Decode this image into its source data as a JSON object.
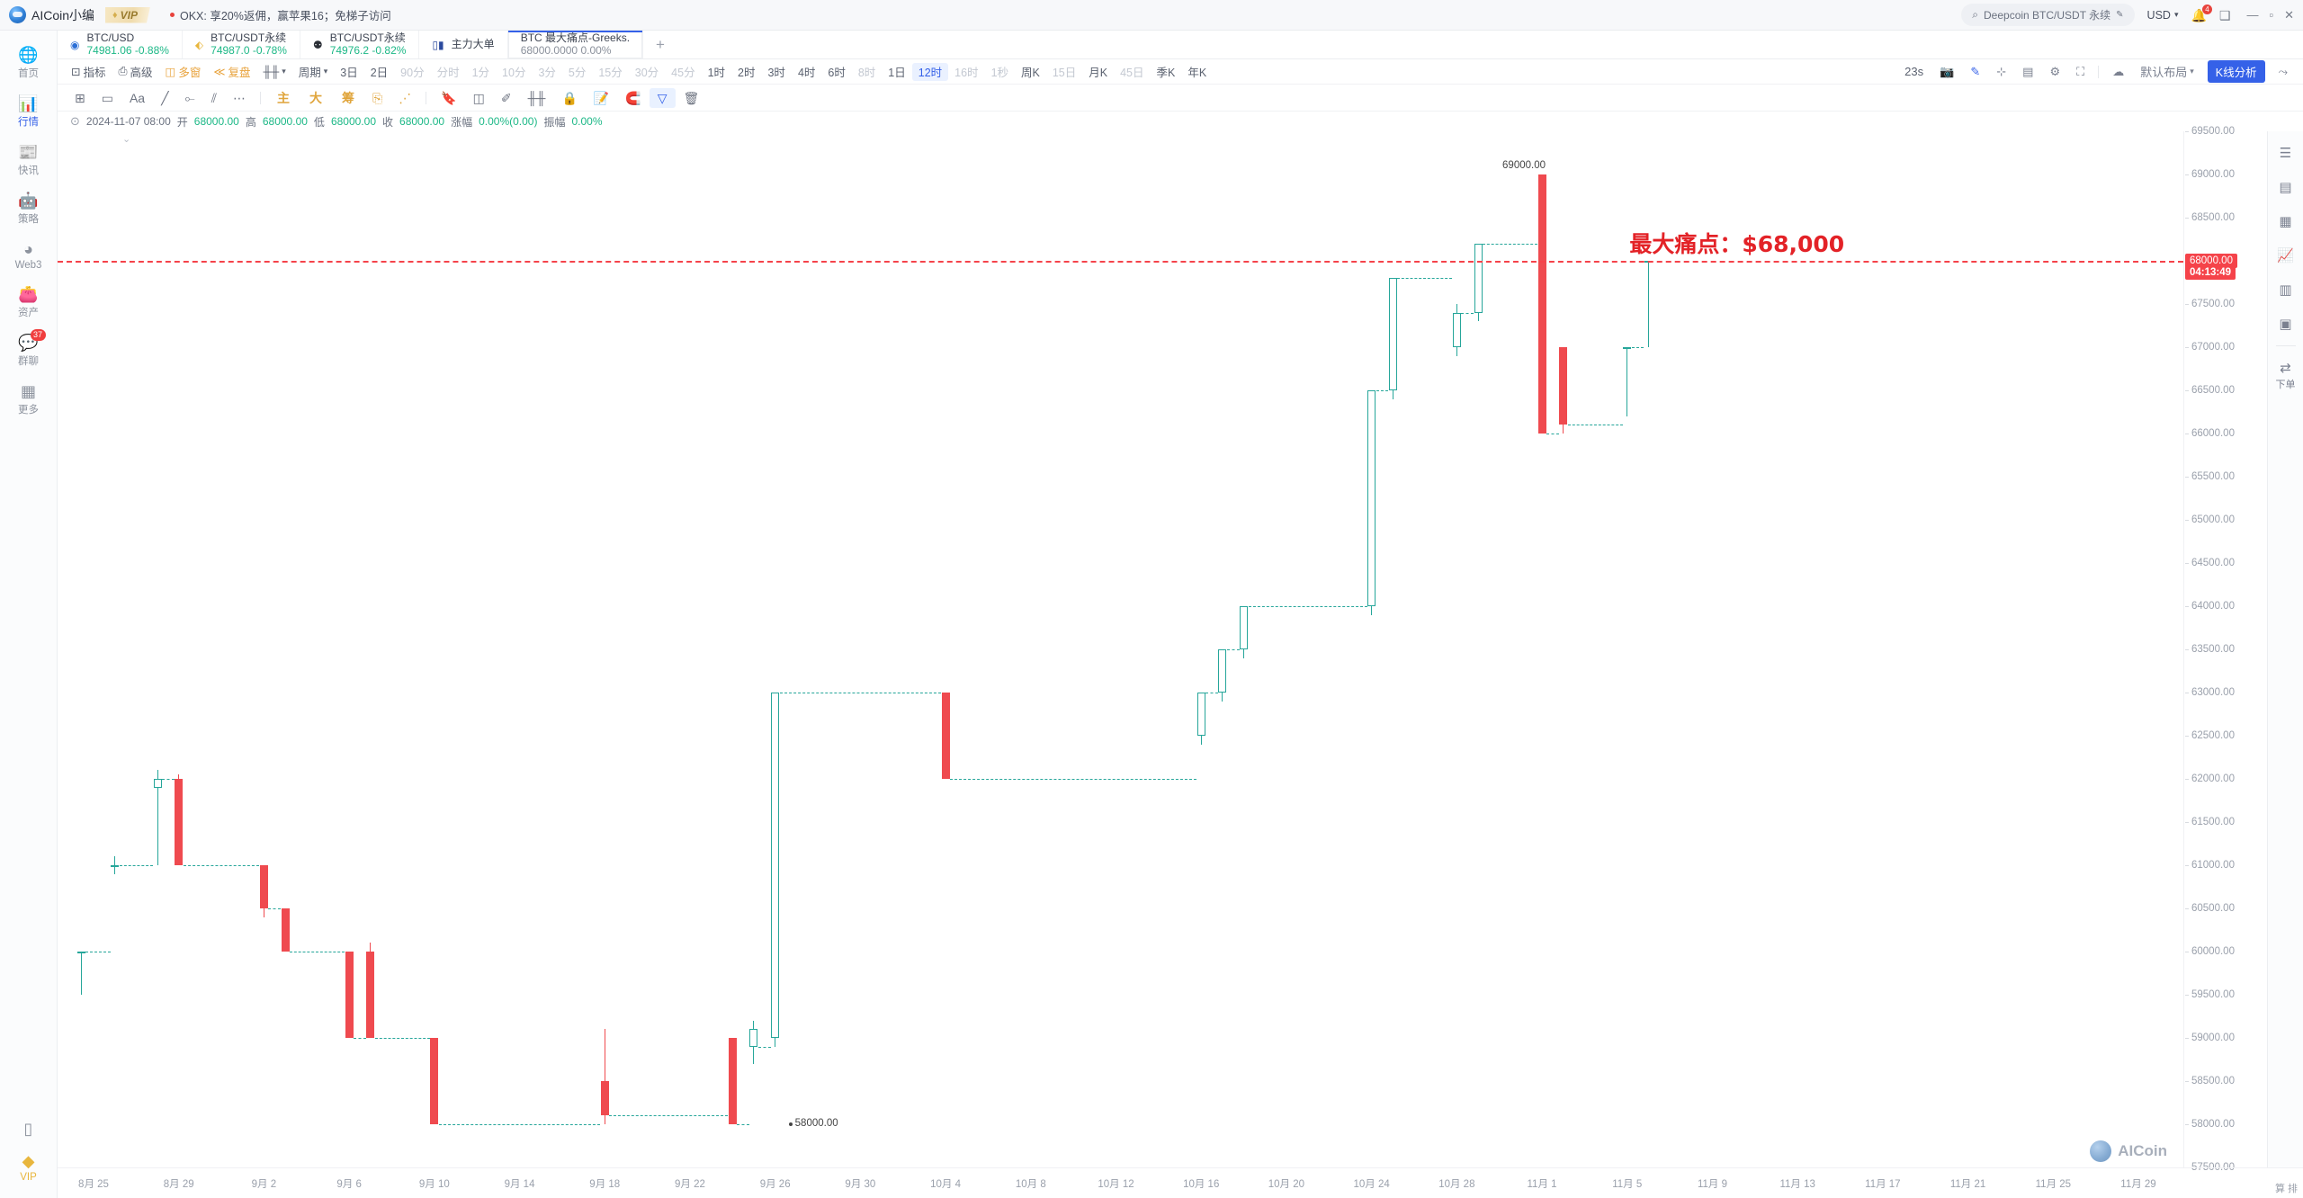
{
  "topbar": {
    "brand": "AICoin小编",
    "vip": "VIP",
    "news": "OKX: 享20%返佣，赢苹果16；免梯子访问",
    "search_placeholder": "Deepcoin BTC/USDT 永续",
    "currency": "USD",
    "notif_count": "4",
    "icons": {
      "search": "search-icon",
      "bell": "bell-icon",
      "window": "window-icon",
      "minimize": "–",
      "maximize": "□",
      "close": "✕"
    }
  },
  "sidebar": {
    "items": [
      {
        "label": "首页",
        "icon": "home-globe-icon",
        "active": false
      },
      {
        "label": "行情",
        "icon": "market-bars-icon",
        "active": true
      },
      {
        "label": "快讯",
        "icon": "news-icon",
        "active": false
      },
      {
        "label": "策略",
        "icon": "robot-icon",
        "active": false
      },
      {
        "label": "Web3",
        "icon": "web3-icon",
        "active": false
      },
      {
        "label": "资产",
        "icon": "wallet-icon",
        "active": false
      },
      {
        "label": "群聊",
        "icon": "chat-icon",
        "active": false,
        "badge": "37"
      },
      {
        "label": "更多",
        "icon": "grid-more-icon",
        "active": false
      }
    ],
    "bottom": [
      {
        "label": "",
        "icon": "mobile-icon"
      },
      {
        "label": "VIP",
        "icon": "vip-diamond-icon"
      }
    ]
  },
  "tabs": [
    {
      "icon": "bullseye-icon",
      "icon_color": "#2b6fd6",
      "name": "BTC/USD",
      "price": "74981.06",
      "change": "-0.88%",
      "active": false
    },
    {
      "icon": "diamond-icon",
      "icon_color": "#e8b63d",
      "name": "BTC/USDT永续",
      "price": "74987.0",
      "change": "-0.78%",
      "active": false
    },
    {
      "icon": "panda-icon",
      "icon_color": "#2b2f36",
      "name": "BTC/USDT永续",
      "price": "74976.2",
      "change": "-0.82%",
      "active": false
    },
    {
      "icon": "candle-icon",
      "icon_color": "#2b4a9e",
      "name": "主力大单",
      "price": "",
      "change": "",
      "active": false
    },
    {
      "icon": "",
      "icon_color": "",
      "name": "BTC 最大痛点-Greeks.",
      "price": "68000.0000",
      "change": "0.00%",
      "active": true
    }
  ],
  "tab_add": "+",
  "period_toolbar": {
    "left_items": [
      {
        "label": "指标",
        "icon": "indicator-icon",
        "state": "normal"
      },
      {
        "label": "高级",
        "icon": "advanced-icon",
        "state": "normal"
      },
      {
        "label": "多窗",
        "icon": "multiwindow-icon",
        "state": "orange"
      },
      {
        "label": "复盘",
        "icon": "replay-icon",
        "state": "orange"
      },
      {
        "label": "",
        "icon": "candle-type-icon",
        "state": "normal",
        "caret": true
      },
      {
        "label": "周期",
        "icon": "",
        "state": "normal",
        "caret": true
      }
    ],
    "periods": [
      {
        "label": "3日",
        "state": "normal"
      },
      {
        "label": "2日",
        "state": "normal"
      },
      {
        "label": "90分",
        "state": "muted"
      },
      {
        "label": "分时",
        "state": "muted"
      },
      {
        "label": "1分",
        "state": "muted"
      },
      {
        "label": "10分",
        "state": "muted"
      },
      {
        "label": "3分",
        "state": "muted"
      },
      {
        "label": "5分",
        "state": "muted"
      },
      {
        "label": "15分",
        "state": "muted"
      },
      {
        "label": "30分",
        "state": "muted"
      },
      {
        "label": "45分",
        "state": "muted"
      },
      {
        "label": "1时",
        "state": "normal"
      },
      {
        "label": "2时",
        "state": "normal"
      },
      {
        "label": "3时",
        "state": "normal"
      },
      {
        "label": "4时",
        "state": "normal"
      },
      {
        "label": "6时",
        "state": "normal"
      },
      {
        "label": "8时",
        "state": "muted"
      },
      {
        "label": "1日",
        "state": "normal"
      },
      {
        "label": "12时",
        "state": "active"
      },
      {
        "label": "16时",
        "state": "muted"
      },
      {
        "label": "1秒",
        "state": "muted"
      },
      {
        "label": "周K",
        "state": "normal"
      },
      {
        "label": "15日",
        "state": "muted"
      },
      {
        "label": "月K",
        "state": "normal"
      },
      {
        "label": "45日",
        "state": "muted"
      },
      {
        "label": "季K",
        "state": "normal"
      },
      {
        "label": "年K",
        "state": "normal"
      }
    ],
    "right": {
      "refresh": "23s",
      "icons": [
        "camera-icon",
        "pencil-icon",
        "crop-icon",
        "layout-icon",
        "settings-icon",
        "fullscreen-icon",
        "cloud-icon"
      ],
      "layout_label": "默认布局",
      "analysis_button": "K线分析",
      "share_icon": "share-icon"
    }
  },
  "draw_toolbar": {
    "left": [
      "crosshair-plus-icon",
      "rectangle-icon",
      "text-Aa-icon",
      "trendline-icon",
      "horizontal-segment-icon",
      "parallel-lines-icon",
      "more-dots-icon"
    ],
    "gold": [
      "主",
      "大",
      "筹"
    ],
    "gold_icons": [
      "magnet-icon",
      "measure-icon"
    ],
    "right": [
      "bookmark-icon",
      "eraser-icon",
      "pen-icon",
      "candle-tool-icon",
      "lock-icon",
      "note-icon",
      "magnet2-icon",
      "filter-icon",
      "trash-icon"
    ],
    "selected": "filter-icon"
  },
  "ohlc": {
    "cycle_icon": "collapse-icon",
    "datetime": "2024-11-07 08:00",
    "open_label": "开",
    "open": "68000.00",
    "high_label": "高",
    "high": "68000.00",
    "low_label": "低",
    "low": "68000.00",
    "close_label": "收",
    "close": "68000.00",
    "change_label": "涨幅",
    "change": "0.00%(0.00)",
    "amp_label": "振幅",
    "amp": "0.00%"
  },
  "annotation": {
    "text": "最大痛点：$68,000",
    "color": "#e32227",
    "line_price": 68000
  },
  "price_badge": {
    "price": "68000.00",
    "countdown": "04:13:49",
    "color": "#f5434a"
  },
  "labels": {
    "high_marker": "69000.00",
    "low_marker": "58000.00"
  },
  "right_rail": {
    "items": [
      {
        "icon": "list-icon",
        "label": ""
      },
      {
        "icon": "layers-icon",
        "label": ""
      },
      {
        "icon": "orderbook-icon",
        "label": ""
      },
      {
        "icon": "chart-up-icon",
        "label": ""
      },
      {
        "icon": "depth-icon",
        "label": ""
      },
      {
        "icon": "etf-icon",
        "label": ""
      },
      {
        "icon": "trade-icon",
        "label": "下单"
      }
    ]
  },
  "watermark": {
    "text": "AICoin"
  },
  "bottom_right_text": "算 排",
  "chart_data": {
    "type": "candlestick",
    "title": "BTC 最大痛点-Greeks.",
    "subtitle": "最大痛点：$68,000",
    "ylabel": "",
    "xlabel": "",
    "ylim": [
      57500,
      69500
    ],
    "y_ticks": [
      69500,
      69000,
      68500,
      68000,
      67500,
      67000,
      66500,
      66000,
      65500,
      65000,
      64500,
      64000,
      63500,
      63000,
      62500,
      62000,
      61500,
      61000,
      60500,
      60000,
      59500,
      59000,
      58500,
      58000,
      57500
    ],
    "x_ticks": [
      "8月 25",
      "8月 29",
      "9月 2",
      "9月 6",
      "9月 10",
      "9月 14",
      "9月 18",
      "9月 22",
      "9月 26",
      "9月 30",
      "10月 4",
      "10月 8",
      "10月 12",
      "10月 16",
      "10月 20",
      "10月 24",
      "10月 28",
      "11月 1",
      "11月 5",
      "11月 9",
      "11月 13",
      "11月 17",
      "11月 21",
      "11月 25",
      "11月 29"
    ],
    "grid": false,
    "pain_point_line": 68000,
    "candles": [
      {
        "x": "8月 24",
        "open": 60000,
        "high": 60000,
        "low": 59500,
        "close": 60000,
        "dir": "up"
      },
      {
        "x": "8月 26",
        "open": 61000,
        "high": 61100,
        "low": 60900,
        "close": 61000,
        "dir": "up"
      },
      {
        "x": "8月 28",
        "open": 61900,
        "high": 62100,
        "low": 61000,
        "close": 62000,
        "dir": "up"
      },
      {
        "x": "8月 29",
        "open": 62000,
        "high": 62050,
        "low": 61000,
        "close": 61000,
        "dir": "down"
      },
      {
        "x": "9月 2",
        "open": 61000,
        "high": 61000,
        "low": 60400,
        "close": 60500,
        "dir": "down"
      },
      {
        "x": "9月 3",
        "open": 60500,
        "high": 60500,
        "low": 60000,
        "close": 60000,
        "dir": "down"
      },
      {
        "x": "9月 6",
        "open": 60000,
        "high": 60000,
        "low": 59000,
        "close": 59000,
        "dir": "down"
      },
      {
        "x": "9月 7",
        "open": 60000,
        "high": 60100,
        "low": 59000,
        "close": 59000,
        "dir": "down"
      },
      {
        "x": "9月 10",
        "open": 59000,
        "high": 59000,
        "low": 58000,
        "close": 58000,
        "dir": "down"
      },
      {
        "x": "9月 18",
        "open": 58500,
        "high": 59100,
        "low": 58000,
        "close": 58100,
        "dir": "down"
      },
      {
        "x": "9月 24",
        "open": 59000,
        "high": 59000,
        "low": 58000,
        "close": 58000,
        "dir": "down"
      },
      {
        "x": "9月 25",
        "open": 59100,
        "high": 59200,
        "low": 58700,
        "close": 58900,
        "dir": "up"
      },
      {
        "x": "9月 26",
        "open": 59000,
        "high": 63000,
        "low": 58900,
        "close": 63000,
        "dir": "up"
      },
      {
        "x": "10月 4",
        "open": 63000,
        "high": 63000,
        "low": 62000,
        "close": 62000,
        "dir": "down"
      },
      {
        "x": "10月 16",
        "open": 62500,
        "high": 63000,
        "low": 62400,
        "close": 63000,
        "dir": "up"
      },
      {
        "x": "10月 17",
        "open": 63000,
        "high": 63500,
        "low": 62900,
        "close": 63500,
        "dir": "up"
      },
      {
        "x": "10月 18",
        "open": 63500,
        "high": 64000,
        "low": 63400,
        "close": 64000,
        "dir": "up"
      },
      {
        "x": "10月 24",
        "open": 64000,
        "high": 66500,
        "low": 63900,
        "close": 66500,
        "dir": "up"
      },
      {
        "x": "10月 25",
        "open": 66500,
        "high": 67800,
        "low": 66400,
        "close": 67800,
        "dir": "up"
      },
      {
        "x": "10月 28",
        "open": 67000,
        "high": 67500,
        "low": 66900,
        "close": 67400,
        "dir": "up"
      },
      {
        "x": "10月 29",
        "open": 67400,
        "high": 68200,
        "low": 67300,
        "close": 68200,
        "dir": "up"
      },
      {
        "x": "11月 1",
        "open": 69000,
        "high": 69000,
        "low": 66000,
        "close": 66000,
        "dir": "down"
      },
      {
        "x": "11月 2",
        "open": 67000,
        "high": 67000,
        "low": 66000,
        "close": 66100,
        "dir": "down"
      },
      {
        "x": "11月 5",
        "open": 67000,
        "high": 67000,
        "low": 66200,
        "close": 67000,
        "dir": "up"
      },
      {
        "x": "11月 6",
        "open": 68000,
        "high": 68000,
        "low": 67000,
        "close": 68000,
        "dir": "up"
      }
    ],
    "annotations": [
      {
        "text": "69000.00",
        "price": 69000,
        "type": "high-marker"
      },
      {
        "text": "58000.00",
        "price": 58000,
        "type": "low-marker"
      },
      {
        "text": "最大痛点：$68,000",
        "price": 68000,
        "type": "pain-point"
      }
    ]
  }
}
